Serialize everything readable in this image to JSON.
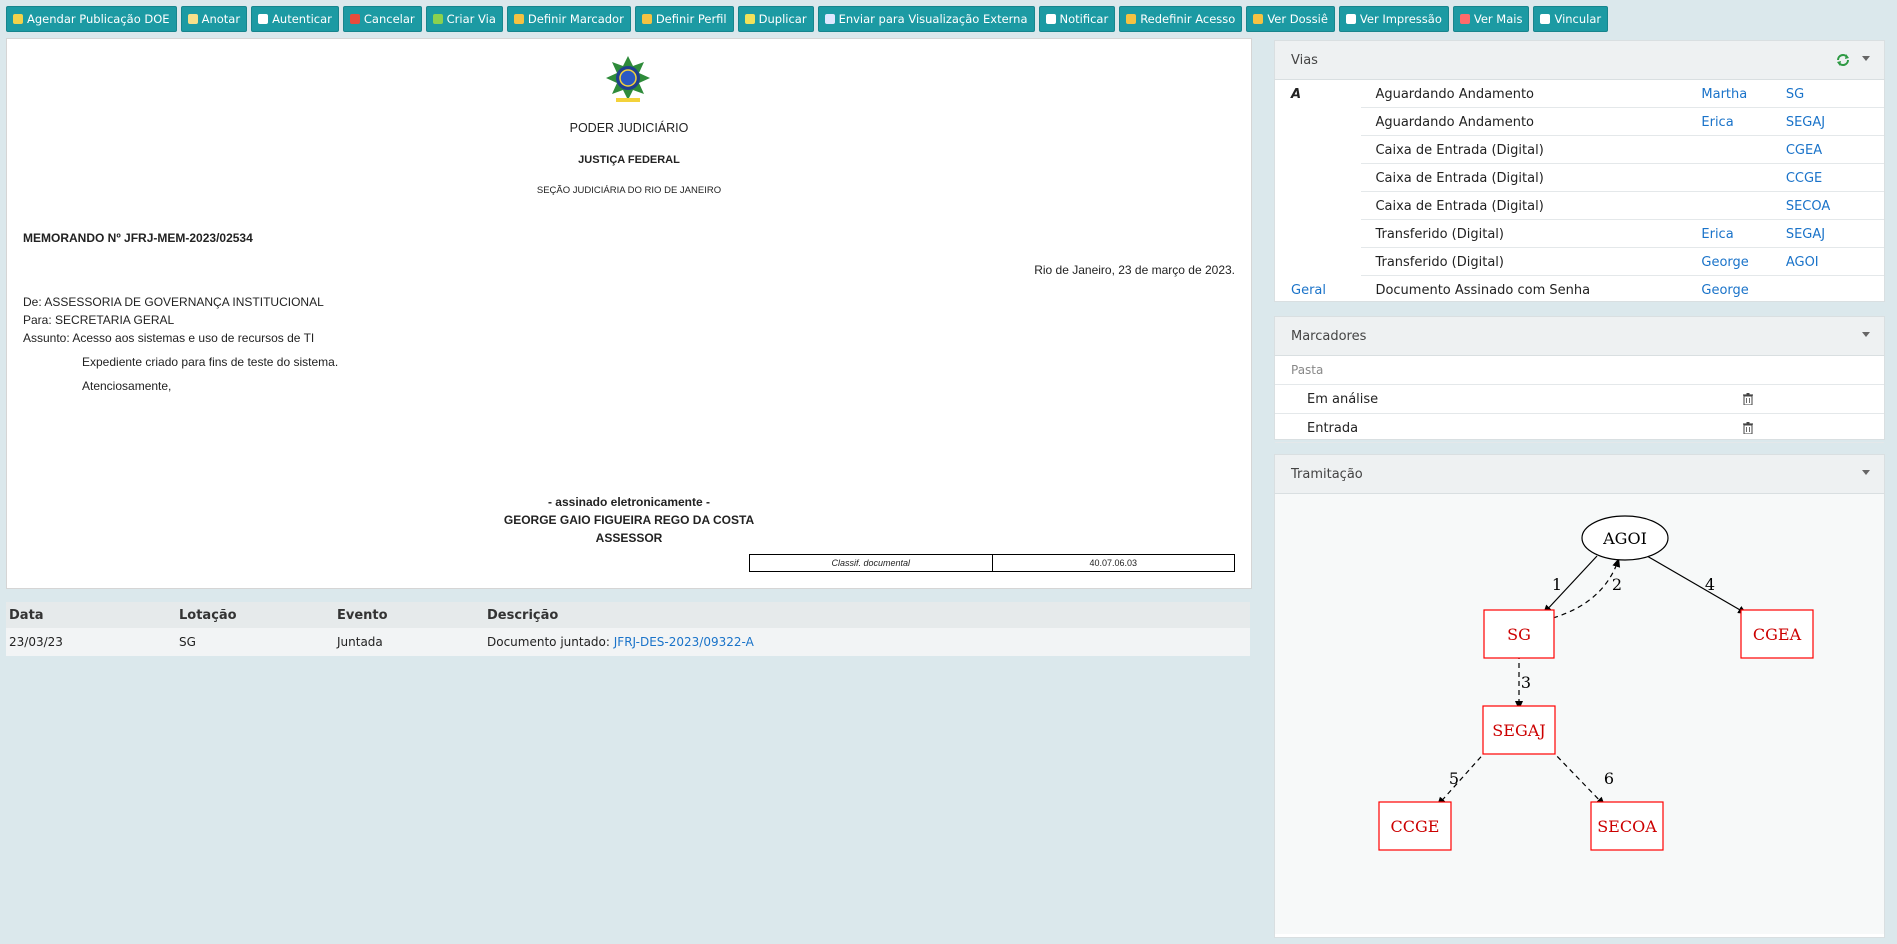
{
  "toolbar": {
    "buttons": [
      {
        "label": "Agendar Publicação DOE",
        "icon": "calendar-icon"
      },
      {
        "label": "Anotar",
        "icon": "note-icon"
      },
      {
        "label": "Autenticar",
        "icon": "authenticate-icon"
      },
      {
        "label": "Cancelar",
        "icon": "cancel-icon"
      },
      {
        "label": "Criar Via",
        "icon": "add-icon"
      },
      {
        "label": "Definir Marcador",
        "icon": "folder-icon"
      },
      {
        "label": "Definir Perfil",
        "icon": "folder-user-icon"
      },
      {
        "label": "Duplicar",
        "icon": "duplicate-icon"
      },
      {
        "label": "Enviar para Visualização Externa",
        "icon": "send-icon"
      },
      {
        "label": "Notificar",
        "icon": "email-icon"
      },
      {
        "label": "Redefinir Acesso",
        "icon": "shield-icon"
      },
      {
        "label": "Ver Dossiê",
        "icon": "folder-open-icon"
      },
      {
        "label": "Ver Impressão",
        "icon": "printer-icon"
      },
      {
        "label": "Ver Mais",
        "icon": "eye-icon"
      },
      {
        "label": "Vincular",
        "icon": "link-icon"
      }
    ]
  },
  "document": {
    "org1": "PODER JUDICIÁRIO",
    "org2": "JUSTIÇA FEDERAL",
    "org3": "SEÇÃO JUDICIÁRIA DO RIO DE JANEIRO",
    "number": "MEMORANDO Nº JFRJ-MEM-2023/02534",
    "date_line": "Rio de Janeiro, 23 de março de 2023.",
    "from": "De: ASSESSORIA DE GOVERNANÇA INSTITUCIONAL",
    "to": "Para: SECRETARIA GERAL",
    "subject": "Assunto: Acesso aos sistemas e uso de recursos de TI",
    "body": "Expediente criado para fins de teste do sistema.",
    "closing": "Atenciosamente,",
    "signed": "- assinado eletronicamente -",
    "signer": "GEORGE GAIO FIGUEIRA REGO DA COSTA",
    "role": "ASSESSOR",
    "classif_label": "Classif. documental",
    "classif_value": "40.07.06.03"
  },
  "movements": {
    "headers": [
      "Data",
      "Lotação",
      "Evento",
      "Descrição"
    ],
    "rows": [
      {
        "date": "23/03/23",
        "unit": "SG",
        "event": "Juntada",
        "desc": "Documento juntado:",
        "link": "JFRJ-DES-2023/09322-A"
      }
    ]
  },
  "vias": {
    "title": "Vias",
    "rows": [
      {
        "via": "A",
        "status": "Aguardando Andamento",
        "person": "Martha",
        "unit": "SG"
      },
      {
        "via": "",
        "status": "Aguardando Andamento",
        "person": "Erica",
        "unit": "SEGAJ"
      },
      {
        "via": "",
        "status": "Caixa de Entrada (Digital)",
        "person": "",
        "unit": "CGEA"
      },
      {
        "via": "",
        "status": "Caixa de Entrada (Digital)",
        "person": "",
        "unit": "CCGE"
      },
      {
        "via": "",
        "status": "Caixa de Entrada (Digital)",
        "person": "",
        "unit": "SECOA"
      },
      {
        "via": "",
        "status": "Transferido (Digital)",
        "person": "Erica",
        "unit": "SEGAJ"
      },
      {
        "via": "",
        "status": "Transferido (Digital)",
        "person": "George",
        "unit": "AGOI"
      },
      {
        "via": "Geral",
        "status": "Documento Assinado com Senha",
        "person": "George",
        "unit": ""
      }
    ]
  },
  "marcadores": {
    "title": "Marcadores",
    "group": "Pasta",
    "items": [
      "Em análise",
      "Entrada"
    ]
  },
  "tramitacao": {
    "title": "Tramitação",
    "nodes": [
      "AGOI",
      "SG",
      "CGEA",
      "SEGAJ",
      "CCGE",
      "SECOA"
    ],
    "edge_labels": [
      "1",
      "2",
      "3",
      "4",
      "5",
      "6"
    ],
    "colors": {
      "node_border": "#ff0000",
      "node_text": "#cc0000"
    }
  }
}
